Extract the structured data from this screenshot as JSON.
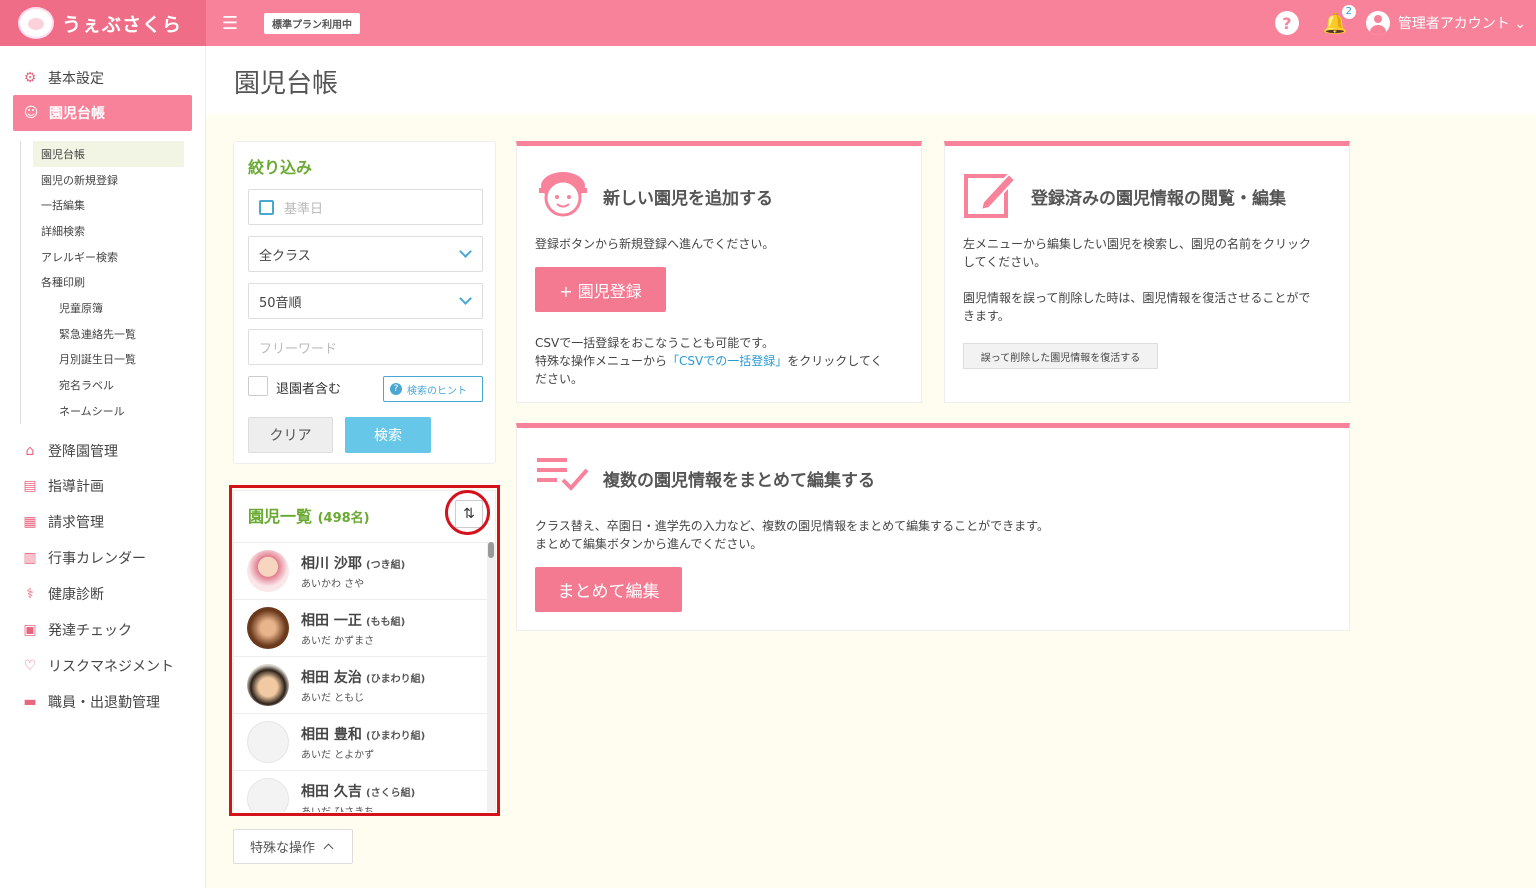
{
  "header": {
    "logo_text": "うぇぶさくら",
    "plan_badge": "標準プラン利用中",
    "help": "?",
    "notification_count": "2",
    "account_label": "管理者アカウント ⌄"
  },
  "sidebar": {
    "items": [
      {
        "label": "基本設定",
        "icon": "gear-icon"
      },
      {
        "label": "園児台帳",
        "icon": "child-face-icon"
      },
      {
        "label": "登降園管理",
        "icon": "building-icon"
      },
      {
        "label": "指導計画",
        "icon": "notebook-icon"
      },
      {
        "label": "請求管理",
        "icon": "calculator-icon"
      },
      {
        "label": "行事カレンダー",
        "icon": "calendar-icon"
      },
      {
        "label": "健康診断",
        "icon": "stethoscope-icon"
      },
      {
        "label": "発達チェック",
        "icon": "clipboard-icon"
      },
      {
        "label": "リスクマネジメント",
        "icon": "hands-heart-icon"
      },
      {
        "label": "職員・出退勤管理",
        "icon": "briefcase-icon"
      }
    ],
    "sub_items": [
      "園児台帳",
      "園児の新規登録",
      "一括編集",
      "詳細検索",
      "アレルギー検索",
      "各種印刷",
      "児童原簿",
      "緊急連絡先一覧",
      "月別誕生日一覧",
      "宛名ラベル",
      "ネームシール"
    ]
  },
  "page": {
    "title": "園児台帳"
  },
  "filter": {
    "heading": "絞り込み",
    "date_placeholder": "基準日",
    "class_select": "全クラス",
    "order_select": "50音順",
    "freeword_placeholder": "フリーワード",
    "include_left": "退園者含む",
    "hint_button": "検索のヒント",
    "clear_button": "クリア",
    "search_button": "検索"
  },
  "list": {
    "heading": "園児一覧",
    "count": "(498名)",
    "sort_icon": "sort-arrows-icon",
    "children": [
      {
        "name": "相川 沙耶",
        "class": "(つき組)",
        "kana": "あいかわ さや"
      },
      {
        "name": "相田 一正",
        "class": "(もも組)",
        "kana": "あいだ かずまさ"
      },
      {
        "name": "相田 友治",
        "class": "(ひまわり組)",
        "kana": "あいだ ともじ"
      },
      {
        "name": "相田 豊和",
        "class": "(ひまわり組)",
        "kana": "あいだ とよかず"
      },
      {
        "name": "相田 久吉",
        "class": "(さくら組)",
        "kana": "あいだ ひさきち"
      }
    ]
  },
  "special_ops": {
    "label": "特殊な操作"
  },
  "card_add": {
    "title": "新しい園児を追加する",
    "text1": "登録ボタンから新規登録へ進んでください。",
    "button": "+ 園児登録",
    "text2a": "CSVで一括登録をおこなうことも可能です。",
    "text2b": "特殊な操作メニューから",
    "text2link": "「CSVでの一括登録」",
    "text2c": "をクリックしてく",
    "text2d": "ださい。"
  },
  "card_edit": {
    "title": "登録済みの園児情報の閲覧・編集",
    "text1a": "左メニューから編集したい園児を検索し、園児の名前をクリック",
    "text1b": "してください。",
    "text2a": "園児情報を誤って削除した時は、園児情報を復活させることがで",
    "text2b": "きます。",
    "restore_button": "誤って削除した園児情報を復活する"
  },
  "card_bulk": {
    "title": "複数の園児情報をまとめて編集する",
    "text1": "クラス替え、卒園日・進学先の入力など、複数の園児情報をまとめて編集することができます。",
    "text2": "まとめて編集ボタンから進んでください。",
    "button": "まとめて編集"
  },
  "colors": {
    "brand_pink": "#f7829a",
    "accent_green": "#6aaa32",
    "accent_blue": "#4aa7d4",
    "highlight_red": "#d4121c"
  }
}
